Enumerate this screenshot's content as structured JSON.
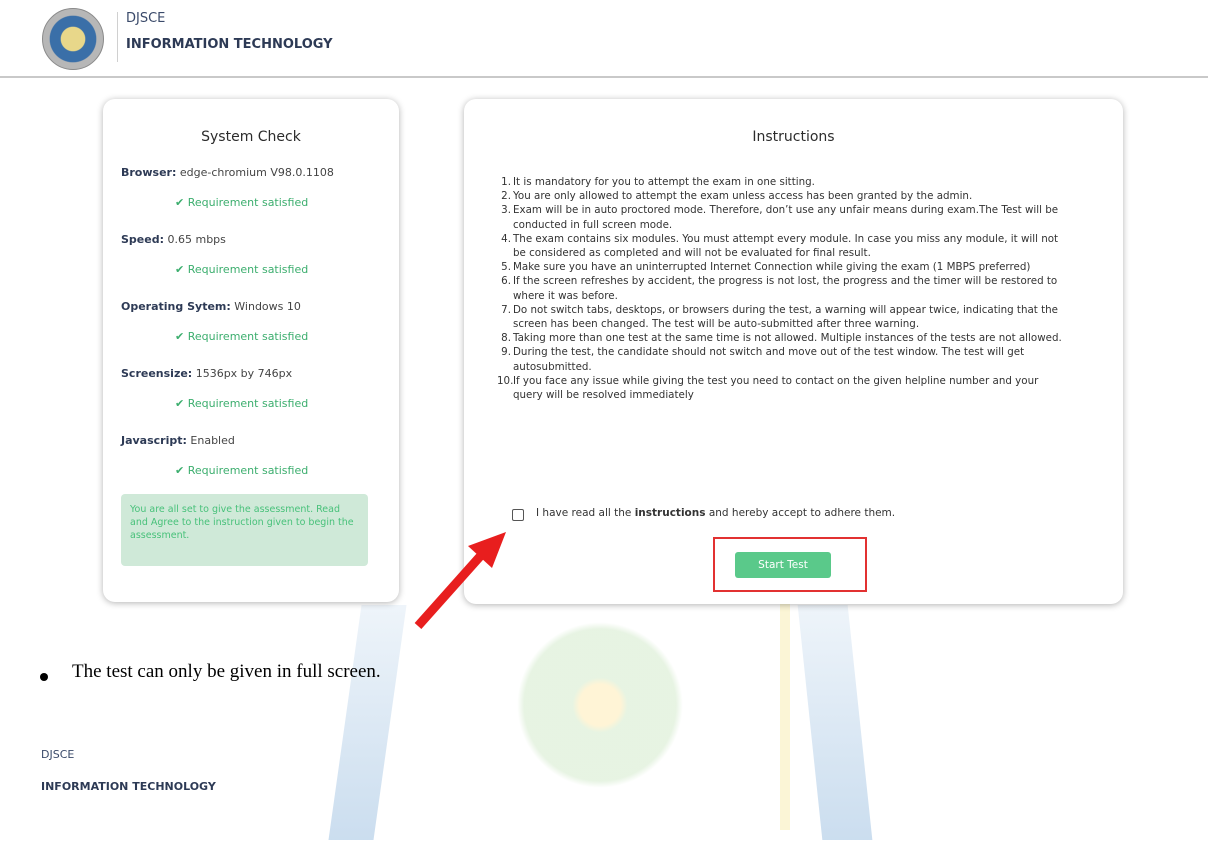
{
  "header": {
    "org": "DJSCE",
    "department": "INFORMATION TECHNOLOGY",
    "logo_icon": "college-crest-icon"
  },
  "system_check": {
    "title": "System Check",
    "items": [
      {
        "label": "Browser:",
        "value": " edge-chromium V98.0.1108",
        "status": "Requirement satisfied"
      },
      {
        "label": "Speed:",
        "value": " 0.65 mbps",
        "status": "Requirement satisfied"
      },
      {
        "label": "Operating Sytem:",
        "value": " Windows 10",
        "status": "Requirement satisfied"
      },
      {
        "label": "Screensize:",
        "value": " 1536px by 746px",
        "status": "Requirement satisfied"
      },
      {
        "label": "Javascript:",
        "value": " Enabled",
        "status": "Requirement satisfied"
      }
    ],
    "check_icon": "✔",
    "notice": "You are all set to give the assessment. Read and Agree to the instruction given to begin the assessment."
  },
  "instructions": {
    "title": "Instructions",
    "items": [
      {
        "num": "1.",
        "text": "It is mandatory for you to attempt the exam in one sitting."
      },
      {
        "num": "2.",
        "text": "You are only allowed to attempt the exam unless access has been granted by the admin."
      },
      {
        "num": "3.",
        "text": "Exam will be in auto proctored mode. Therefore, don’t use any unfair means during exam.The Test will be conducted in full screen mode."
      },
      {
        "num": "4.",
        "text": "The exam contains six modules. You must attempt every module. In case you miss any module, it will not be considered as completed and will not be evaluated for final result."
      },
      {
        "num": "5.",
        "text": "Make sure you have an uninterrupted Internet Connection while giving the exam (1 MBPS preferred)"
      },
      {
        "num": "6.",
        "text": "If the screen refreshes by accident, the progress is not lost, the progress and the timer will be restored to where it was before."
      },
      {
        "num": "7.",
        "text": "Do not switch tabs, desktops, or browsers during the test, a warning will appear twice, indicating that the screen has been changed. The test will be auto-submitted after three warning."
      },
      {
        "num": "8.",
        "text": "Taking more than one test at the same time is not allowed. Multiple instances of the tests are not allowed."
      },
      {
        "num": "9.",
        "text": "During the test, the candidate should not switch and move out of the test window. The test will get autosubmitted."
      },
      {
        "num": "10.",
        "text": "If you face any issue while giving the test you need to contact on the given helpline number and your query will be resolved immediately"
      }
    ],
    "agree_prefix": "I have read all the ",
    "agree_bold": "instructions",
    "agree_suffix": " and hereby accept to adhere them.",
    "agree_checked": false,
    "start_button": "Start Test"
  },
  "caption": {
    "bullet_text": "The test can only be given in full screen."
  },
  "footer": {
    "org": "DJSCE",
    "department": "INFORMATION TECHNOLOGY"
  },
  "colors": {
    "accent_green": "#5ac98a",
    "highlight_red": "#e23131",
    "notice_bg": "#cfe9d8"
  }
}
